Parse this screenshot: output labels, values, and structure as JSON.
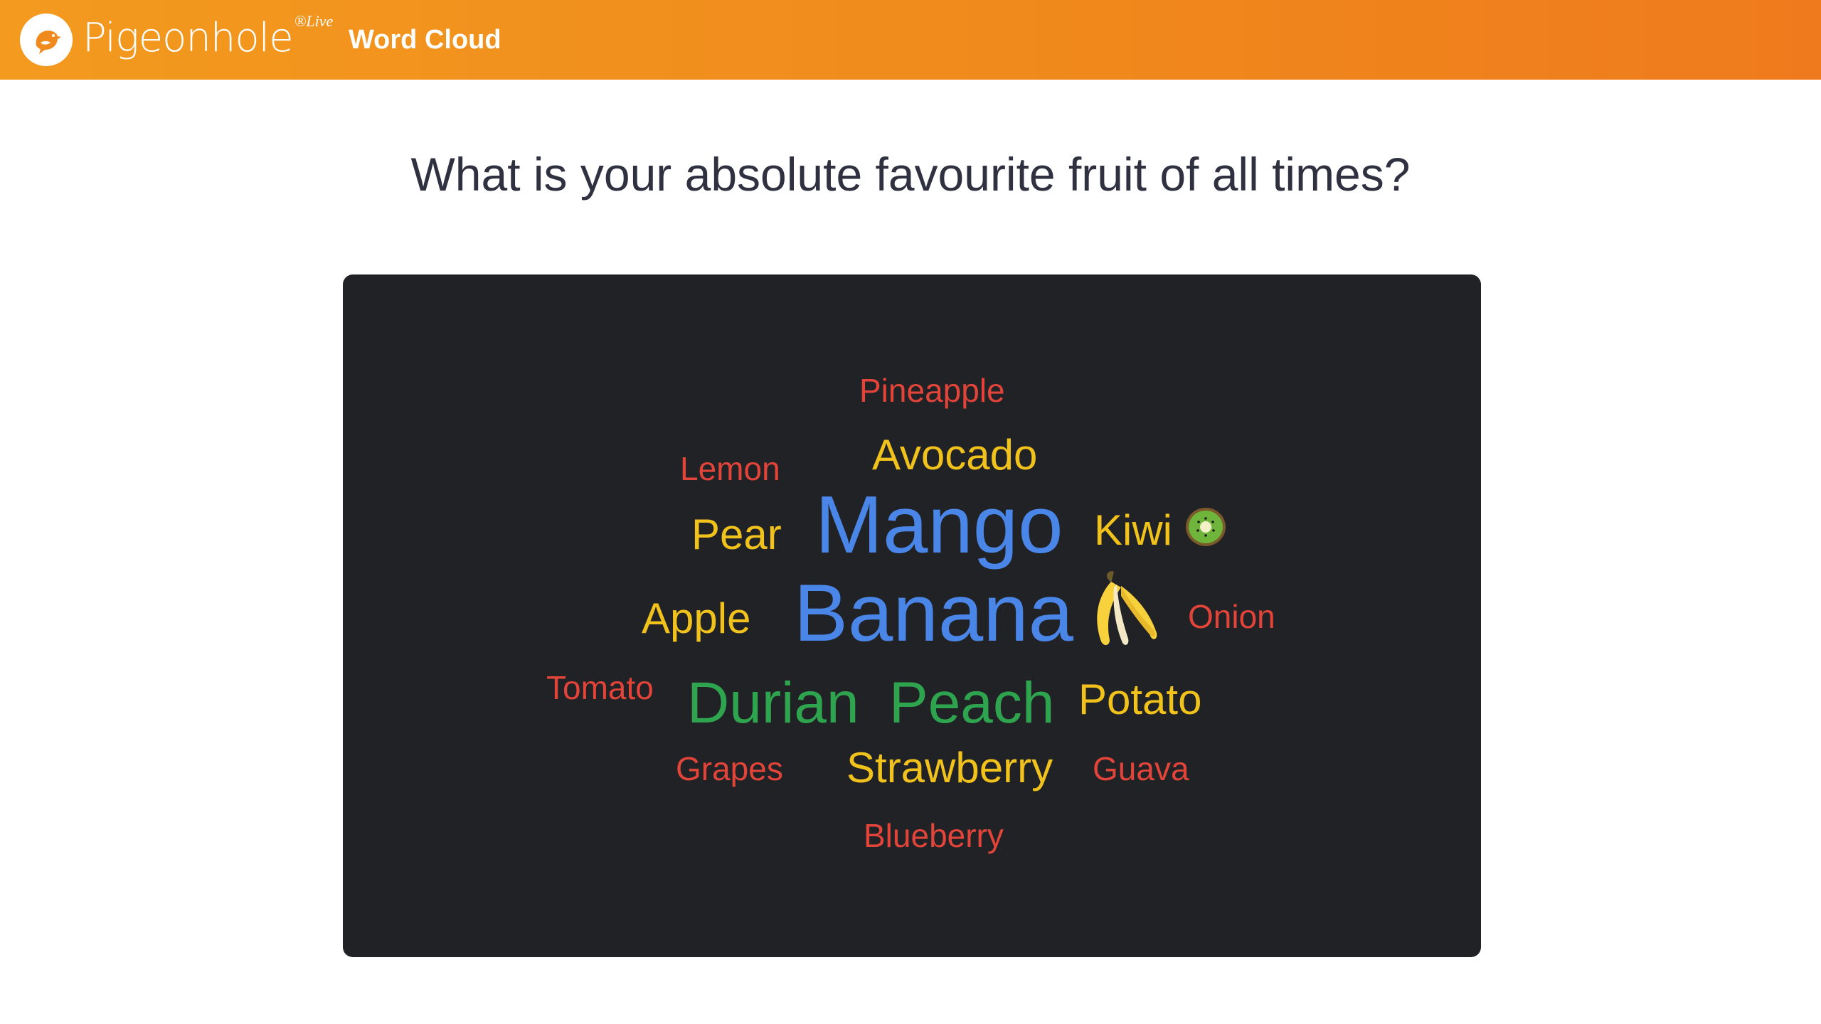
{
  "header": {
    "logo_text": "Pigeonhole",
    "logo_sup": "®Live",
    "title": "Word Cloud",
    "background_start": "#f39a1f",
    "background_end": "#ef7a1d"
  },
  "question": "What is your absolute favourite fruit of all times?",
  "cloud": {
    "background": "#212226",
    "colors": {
      "blue": "#4a86e8",
      "green": "#2ea44f",
      "yellow": "#f1c21b",
      "red": "#e2443a"
    },
    "words": [
      {
        "text": "Pineapple",
        "color": "red"
      },
      {
        "text": "Lemon",
        "color": "red"
      },
      {
        "text": "Avocado",
        "color": "yellow"
      },
      {
        "text": "Pear",
        "color": "yellow"
      },
      {
        "text": "Mango",
        "color": "blue"
      },
      {
        "text": "Kiwi",
        "color": "yellow",
        "icon": "kiwi-icon"
      },
      {
        "text": "Apple",
        "color": "yellow"
      },
      {
        "text": "Banana",
        "color": "blue",
        "icon": "banana-icon"
      },
      {
        "text": "Onion",
        "color": "red"
      },
      {
        "text": "Tomato",
        "color": "red"
      },
      {
        "text": "Durian",
        "color": "green"
      },
      {
        "text": "Peach",
        "color": "green"
      },
      {
        "text": "Potato",
        "color": "yellow"
      },
      {
        "text": "Grapes",
        "color": "red"
      },
      {
        "text": "Strawberry",
        "color": "yellow"
      },
      {
        "text": "Guava",
        "color": "red"
      },
      {
        "text": "Blueberry",
        "color": "red"
      }
    ]
  }
}
